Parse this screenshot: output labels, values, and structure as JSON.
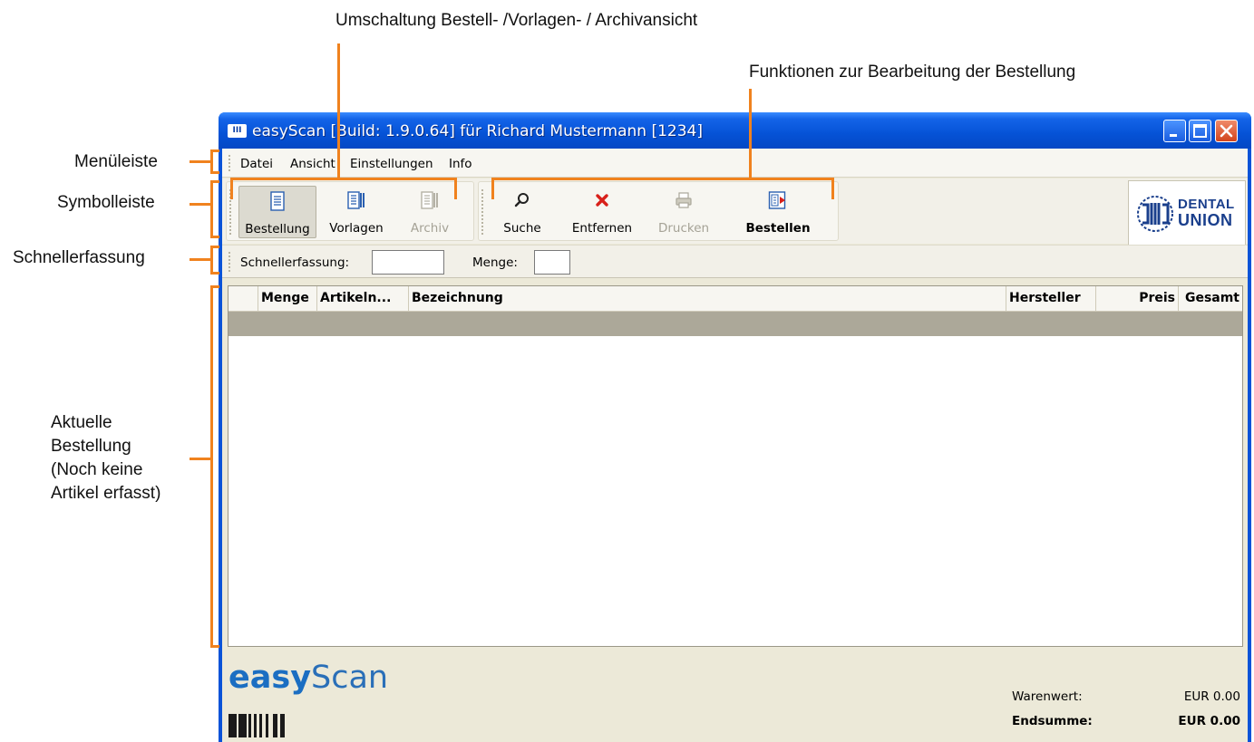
{
  "annotations": {
    "view_switch": "Umschaltung Bestell- /Vorlagen- / Archivansicht",
    "edit_functions": "Funktionen zur Bearbeitung der Bestellung",
    "menubar": "Menüleiste",
    "toolbar": "Symbolleiste",
    "quick_entry": "Schnellerfassung",
    "current_order": [
      "Aktuelle",
      "Bestellung",
      "(Noch keine",
      "Artikel erfasst)"
    ]
  },
  "window": {
    "icon_text": "III",
    "title": "easyScan [Build: 1.9.0.64] für Richard Mustermann [1234]"
  },
  "menu": [
    "Datei",
    "Ansicht",
    "Einstellungen",
    "Info"
  ],
  "toolbar": {
    "view_buttons": [
      {
        "label": "Bestellung",
        "icon": "order-document-icon",
        "state": "active"
      },
      {
        "label": "Vorlagen",
        "icon": "templates-icon",
        "state": "normal"
      },
      {
        "label": "Archiv",
        "icon": "archive-icon",
        "state": "disabled"
      }
    ],
    "action_buttons": [
      {
        "label": "Suche",
        "icon": "search-icon",
        "state": "normal"
      },
      {
        "label": "Entfernen",
        "icon": "remove-icon",
        "state": "normal"
      },
      {
        "label": "Drucken",
        "icon": "printer-icon",
        "state": "disabled"
      },
      {
        "label": "Bestellen",
        "icon": "send-order-icon",
        "state": "normal"
      }
    ],
    "logo": [
      "DENTAL",
      "UNION"
    ]
  },
  "quick_entry": {
    "label": "Schnellerfassung:",
    "quantity_label": "Menge:",
    "value": "",
    "quantity_value": ""
  },
  "grid": {
    "columns": [
      "",
      "Menge",
      "Artikeln...",
      "Bezeichnung",
      "Hersteller",
      "Preis",
      "Gesamt"
    ],
    "rows": []
  },
  "footer": {
    "brand_easy": "easy",
    "brand_scan": "Scan",
    "warenwert_label": "Warenwert:",
    "warenwert_value": "EUR 0.00",
    "endsumme_label": "Endsumme:",
    "endsumme_value": "EUR 0.00"
  },
  "colors": {
    "annotation": "#f0821e",
    "titlebar": "#0552d6",
    "selection_row": "#aca899",
    "brand": "#1b6ec2"
  }
}
